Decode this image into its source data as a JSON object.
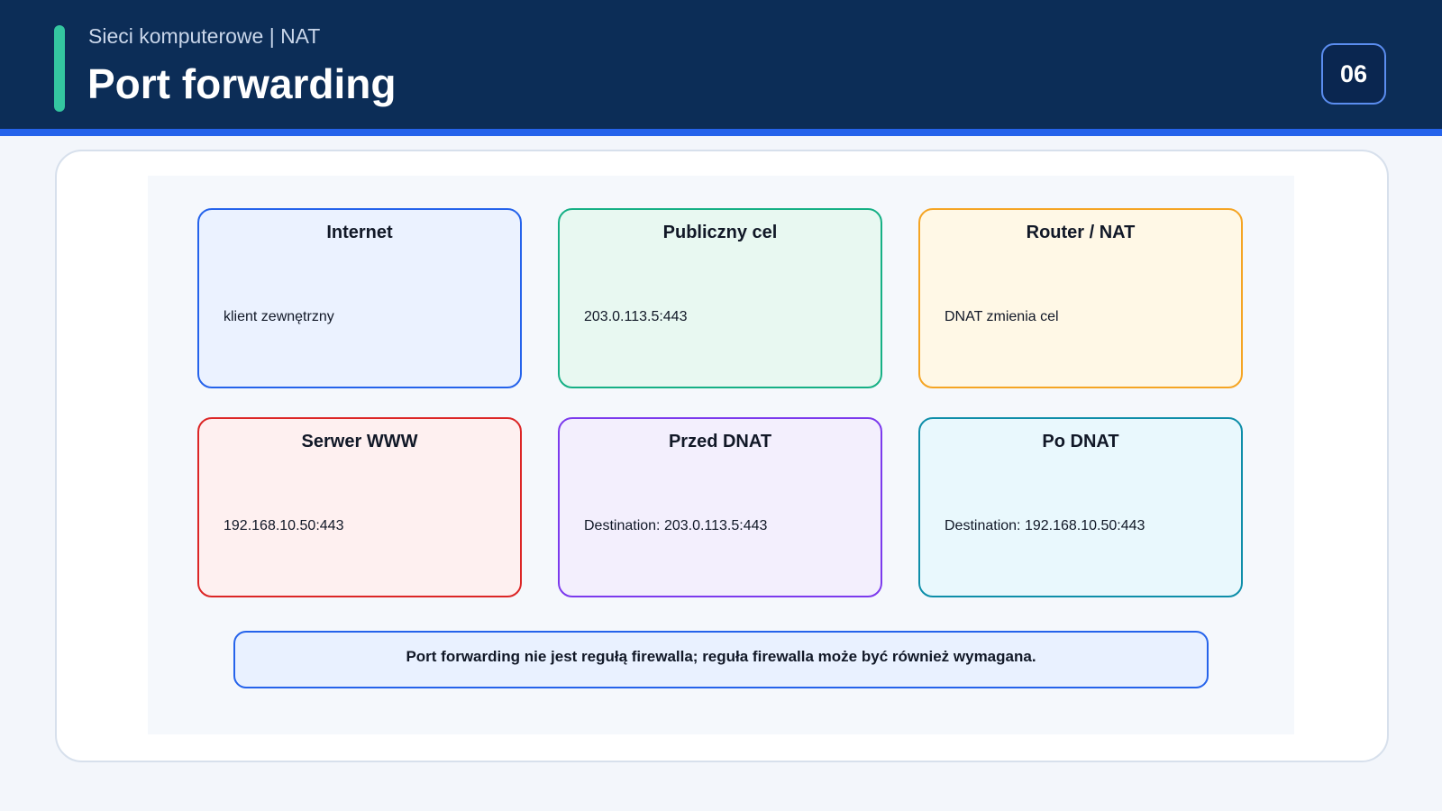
{
  "header": {
    "subtitle": "Sieci komputerowe | NAT",
    "title": "Port forwarding",
    "page_number": "06"
  },
  "diagram": {
    "boxes": [
      {
        "title": "Internet",
        "text": "klient zewnętrzny",
        "border": "#2563eb",
        "fill": "#ebf2ff"
      },
      {
        "title": "Publiczny cel",
        "text": "203.0.113.5:443",
        "border": "#16b085",
        "fill": "#e8f8f1"
      },
      {
        "title": "Router / NAT",
        "text": "DNAT zmienia cel",
        "border": "#f5a524",
        "fill": "#fff8e6"
      },
      {
        "title": "Serwer WWW",
        "text": "192.168.10.50:443",
        "border": "#dc2626",
        "fill": "#fef0f0"
      },
      {
        "title": "Przed DNAT",
        "text": "Destination: 203.0.113.5:443",
        "border": "#7c3aed",
        "fill": "#f3effd"
      },
      {
        "title": "Po DNAT",
        "text": "Destination: 192.168.10.50:443",
        "border": "#0e8ea9",
        "fill": "#e9f8fd"
      }
    ],
    "note": "Port forwarding nie jest regułą firewalla; reguła firewalla może być również wymagana."
  },
  "colors": {
    "header_bg": "#0c2d57",
    "header_rule": "#2563eb",
    "accent": "#34c6a0"
  }
}
